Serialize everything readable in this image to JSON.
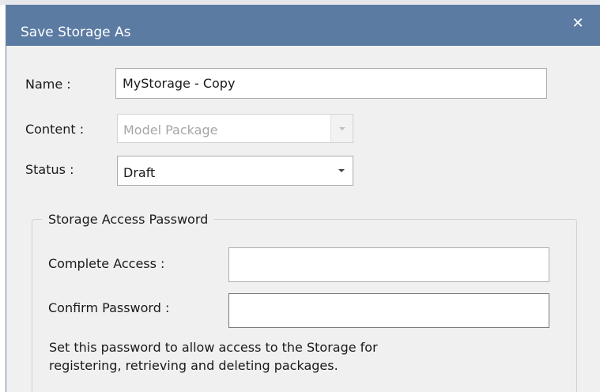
{
  "dialog": {
    "title": "Save Storage As",
    "close_glyph": "✕"
  },
  "form": {
    "name_label": "Name :",
    "name_value": "MyStorage - Copy",
    "content_label": "Content :",
    "content_value": "Model Package",
    "status_label": "Status :",
    "status_value": "Draft"
  },
  "password_group": {
    "legend": "Storage Access Password",
    "complete_access_label": "Complete Access :",
    "complete_access_value": "",
    "confirm_password_label": "Confirm Password :",
    "confirm_password_value": "",
    "help_line1": "Set this password to allow access to the Storage for",
    "help_line2": "registering, retrieving and deleting packages."
  },
  "icons": {
    "close": "close-icon",
    "dropdown": "chevron-down-icon"
  },
  "colors": {
    "titlebar": "#5b7ba3",
    "dialog_bg": "#f0f0f0",
    "disabled_text": "#a6a6a6"
  }
}
